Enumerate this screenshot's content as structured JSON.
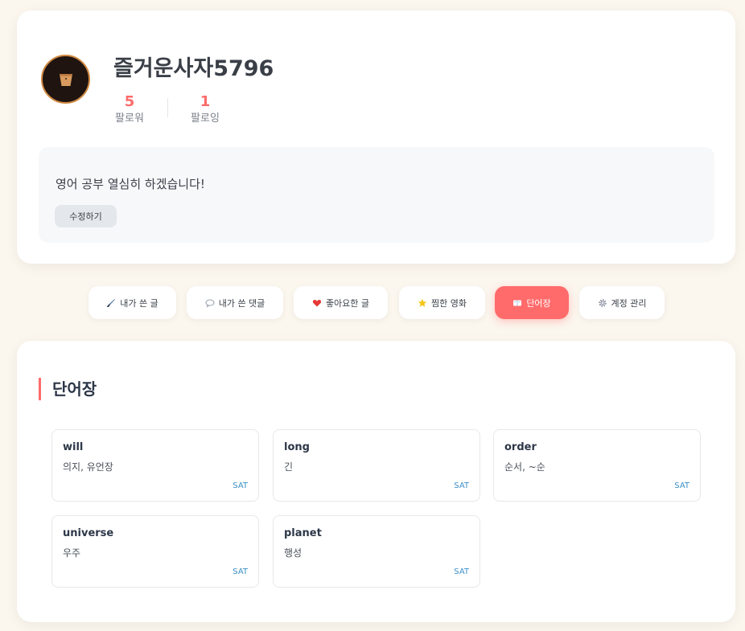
{
  "profile": {
    "username": "즐거운사자5796",
    "followers": {
      "count": "5",
      "label": "팔로워"
    },
    "following": {
      "count": "1",
      "label": "팔로잉"
    },
    "bio": "영어 공부 열심히 하겠습니다!",
    "edit_label": "수정하기"
  },
  "tabs": [
    {
      "icon": "brush-icon",
      "label": "내가 쓴 글"
    },
    {
      "icon": "speech-bubble-icon",
      "label": "내가 쓴 댓글"
    },
    {
      "icon": "heart-icon",
      "label": "좋아요한 글"
    },
    {
      "icon": "star-icon",
      "label": "찜한 영화"
    },
    {
      "icon": "book-icon",
      "label": "단어장"
    },
    {
      "icon": "gear-icon",
      "label": "계정 관리"
    }
  ],
  "active_tab": "단어장",
  "section": {
    "title": "단어장"
  },
  "words": [
    {
      "term": "will",
      "meaning": "의지, 유언장",
      "tag": "SAT"
    },
    {
      "term": "long",
      "meaning": "긴",
      "tag": "SAT"
    },
    {
      "term": "order",
      "meaning": "순서, ~순",
      "tag": "SAT"
    },
    {
      "term": "universe",
      "meaning": "우주",
      "tag": "SAT"
    },
    {
      "term": "planet",
      "meaning": "행성",
      "tag": "SAT"
    }
  ],
  "colors": {
    "accent": "#ff6b6b",
    "background": "#fbf6ee",
    "tag": "#3b8fc9"
  }
}
